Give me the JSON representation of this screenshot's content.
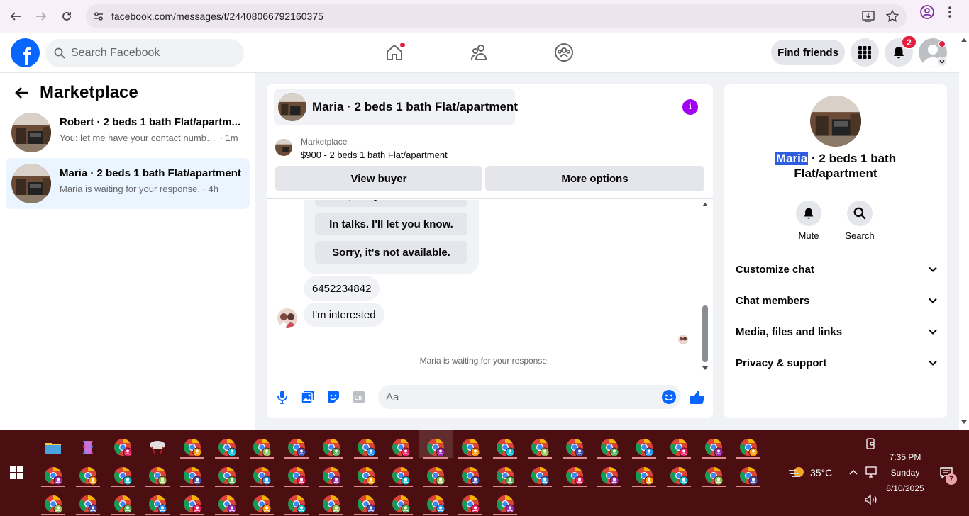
{
  "browser": {
    "url": "facebook.com/messages/t/24408066792160375"
  },
  "fb_nav": {
    "search_placeholder": "Search Facebook",
    "find_friends": "Find friends",
    "notification_count": "2"
  },
  "sidebar": {
    "title": "Marketplace",
    "conversations": [
      {
        "title": "Robert · 2 beds 1 bath Flat/apartm...",
        "snippet": "You: let me have your contact numbe...",
        "time": "· 1m",
        "active": false
      },
      {
        "title": "Maria · 2 beds 1 bath Flat/apartment",
        "snippet": "Maria is waiting for your response.",
        "time": "· 4h",
        "active": true
      }
    ]
  },
  "chat": {
    "header_title": "Maria · 2 beds 1 bath Flat/apartment",
    "info_icon": "i",
    "listing_label": "Marketplace",
    "listing_price": "$900 - 2 beds 1 bath Flat/apartment",
    "view_buyer": "View buyer",
    "more_options": "More options",
    "quick_replies": [
      "Yes, are you interested?",
      "In talks. I'll let you know.",
      "Sorry, it's not available."
    ],
    "messages": [
      "6452234842",
      "I'm interested"
    ],
    "waiting_text": "Maria is waiting for your response.",
    "composer_placeholder": "Aa"
  },
  "details": {
    "name_highlight": "Maria",
    "name_rest": " · 2 beds 1 bath Flat/apartment",
    "mute": "Mute",
    "search": "Search",
    "sections": [
      "Customize chat",
      "Chat members",
      "Media, files and links",
      "Privacy & support"
    ]
  },
  "taskbar": {
    "temperature": "35°C",
    "time": "7:35 PM",
    "day": "Sunday",
    "date": "8/10/2025",
    "notification_count": "7"
  }
}
